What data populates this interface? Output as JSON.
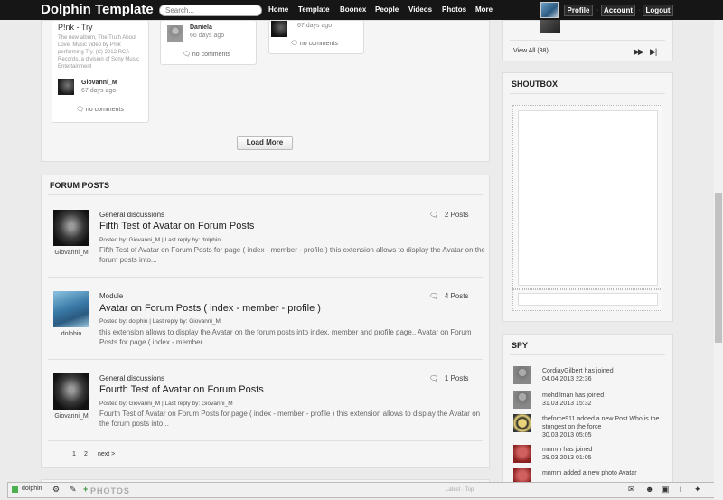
{
  "header": {
    "logo": "Dolphin Template",
    "search_placeholder": "Search...",
    "menu": [
      "Home",
      "Template",
      "Boonex",
      "People",
      "Videos",
      "Photos",
      "More"
    ],
    "profile": "Profile",
    "account": "Account",
    "logout": "Logout"
  },
  "videos": {
    "card1": {
      "title": "P!nk - Try",
      "desc": "The new album, The Truth About Love, Music video by P!nk performing Try. (C) 2012 RCA Records, a division of Sony Music Entertainment",
      "user": "Giovanni_M",
      "ago": "67 days ago",
      "comments": "no comments"
    },
    "card2": {
      "user": "Daniela",
      "ago": "66 days ago",
      "comments": "no comments"
    },
    "card3": {
      "ago": "67 days ago",
      "comments": "no comments"
    },
    "load_more": "Load More"
  },
  "forum": {
    "title": "FORUM POSTS",
    "posts": [
      {
        "category": "General discussions",
        "title": "Fifth Test of Avatar on Forum Posts",
        "meta": "Posted by: Giovanni_M | Last reply by: dolphin",
        "text": "Fifth Test of Avatar on Forum Posts for page ( index - member - profile ) this extension allows to display the Avatar on the forum posts into...",
        "count": "2 Posts",
        "user": "Giovanni_M"
      },
      {
        "category": "Module",
        "title": "Avatar on Forum Posts ( index - member - profile )",
        "meta": "Posted by: dolphin | Last reply by: Giovanni_M",
        "text": "this extension allows to display the Avatar on the forum posts into index, member and profile page.. Avatar on Forum Posts for page ( index - member...",
        "count": "4 Posts",
        "user": "dolphin"
      },
      {
        "category": "General discussions",
        "title": "Fourth Test of Avatar on Forum Posts",
        "meta": "Posted by: Giovanni_M | Last reply by: Giovanni_M",
        "text": "Fourth Test of Avatar on Forum Posts for page ( index - member - profile ) this extension allows to display the Avatar on the forum posts into...",
        "count": "1 Posts",
        "user": "Giovanni_M"
      }
    ],
    "pager": {
      "p1": "1",
      "p2": "2",
      "next": "next >"
    }
  },
  "members": {
    "view_all": "View All (38)"
  },
  "shoutbox": {
    "title": "SHOUTBOX"
  },
  "spy": {
    "title": "SPY",
    "items": [
      {
        "text": "CordiayGilbert has joined",
        "time": "04.04.2013 22:36"
      },
      {
        "text": "mohdilman has joined",
        "time": "31.03.2013 15:32"
      },
      {
        "text": "theforce911 added a new Post Who is the stongest on the force",
        "time": "30.03.2013 05:05"
      },
      {
        "text": "mnmm has joined",
        "time": "29.03.2013 01:05"
      },
      {
        "text": "mnmm added a new photo Avatar",
        "time": ""
      }
    ]
  },
  "bottom": {
    "user": "dolphin",
    "photos": "PHOTOS",
    "links": "Latest · Top"
  }
}
